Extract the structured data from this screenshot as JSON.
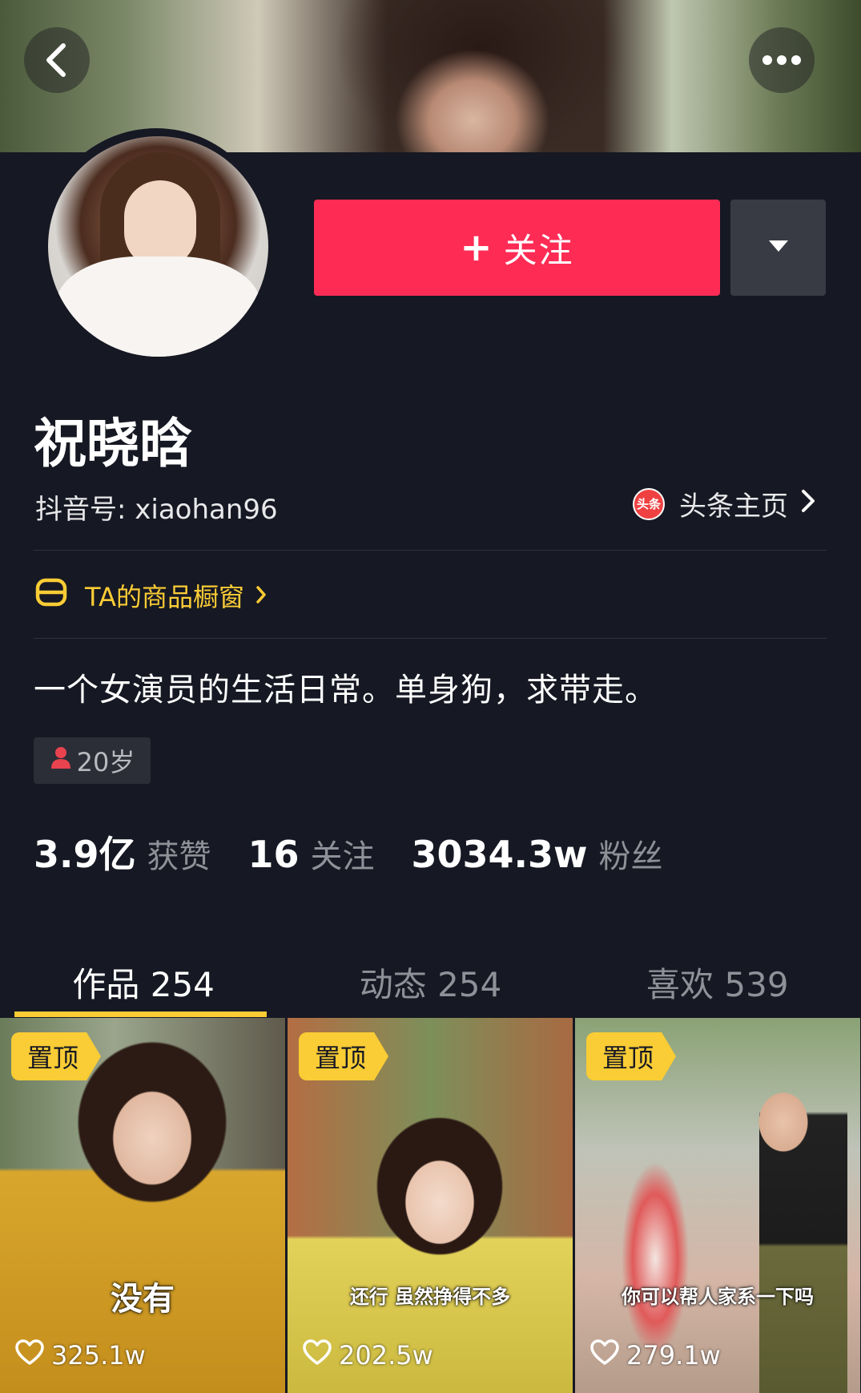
{
  "colors": {
    "background": "#161823",
    "accent": "#fe2c55",
    "highlight": "#facc35"
  },
  "header": {
    "back_icon": "chevron-left-icon",
    "more_icon": "more-dots-icon"
  },
  "profile": {
    "follow_label": "关注",
    "name": "祝晓晗",
    "douyin_id": "抖音号: xiaohan96",
    "toutiao_logo_text": "头条",
    "toutiao_label": "头条主页",
    "shop_label": "TA的商品橱窗",
    "bio": "一个女演员的生活日常。单身狗，求带走。",
    "age_tag": "20岁"
  },
  "stats": [
    {
      "value": "3.9亿",
      "label": "获赞"
    },
    {
      "value": "16",
      "label": "关注"
    },
    {
      "value": "3034.3w",
      "label": "粉丝"
    }
  ],
  "tabs": [
    {
      "label": "作品 254",
      "active": true
    },
    {
      "label": "动态 254",
      "active": false
    },
    {
      "label": "喜欢 539",
      "active": false
    }
  ],
  "videos": [
    {
      "pin": "置顶",
      "caption": "没有",
      "likes": "325.1w"
    },
    {
      "pin": "置顶",
      "caption": "还行 虽然挣得不多",
      "likes": "202.5w"
    },
    {
      "pin": "置顶",
      "caption": "你可以帮人家系一下吗",
      "likes": "279.1w"
    }
  ]
}
